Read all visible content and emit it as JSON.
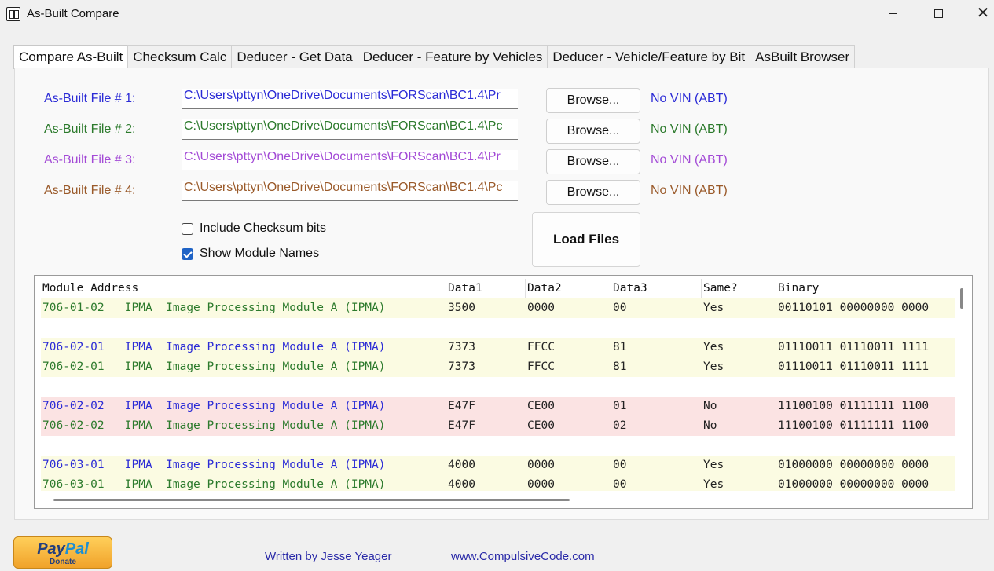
{
  "window": {
    "title": "As-Built Compare",
    "controls": {
      "minimize": "minimize-icon",
      "maximize": "maximize-icon",
      "close": "close-icon"
    }
  },
  "tabs": [
    {
      "label": "Compare As-Built",
      "active": true
    },
    {
      "label": "Checksum Calc"
    },
    {
      "label": "Deducer - Get Data"
    },
    {
      "label": "Deducer - Feature by Vehicles"
    },
    {
      "label": "Deducer - Vehicle/Feature by Bit"
    },
    {
      "label": "AsBuilt Browser"
    }
  ],
  "files": [
    {
      "label": "As-Built File # 1:",
      "path": "C:\\Users\\pttyn\\OneDrive\\Documents\\FORScan\\BC1.4\\Pr",
      "browse": "Browse...",
      "vin": "No VIN (ABT)",
      "color": "#2b2bd6"
    },
    {
      "label": "As-Built File # 2:",
      "path": "C:\\Users\\pttyn\\OneDrive\\Documents\\FORScan\\BC1.4\\Pc",
      "browse": "Browse...",
      "vin": "No VIN (ABT)",
      "color": "#2c7a2c"
    },
    {
      "label": "As-Built File # 3:",
      "path": "C:\\Users\\pttyn\\OneDrive\\Documents\\FORScan\\BC1.4\\Pr",
      "browse": "Browse...",
      "vin": "No VIN (ABT)",
      "color": "#a34ad6"
    },
    {
      "label": "As-Built File # 4:",
      "path": "C:\\Users\\pttyn\\OneDrive\\Documents\\FORScan\\BC1.4\\Pc",
      "browse": "Browse...",
      "vin": "No VIN (ABT)",
      "color": "#9a5a2a"
    }
  ],
  "options": {
    "include_checksum": {
      "label": "Include Checksum bits",
      "checked": false
    },
    "show_module_names": {
      "label": "Show Module Names",
      "checked": true
    }
  },
  "load_button": "Load Files",
  "grid": {
    "headers": [
      "Module Address",
      "Data1",
      "Data2",
      "Data3",
      "Same?",
      "Binary"
    ],
    "rows": [
      {
        "addr": "706-01-02   IPMA  Image Processing Module A (IPMA)",
        "d1": "3500",
        "d2": "0000",
        "d3": "00",
        "same": "Yes",
        "bin": "00110101 00000000 0000",
        "bg": "yellow",
        "color": "#2c7a2c"
      },
      {
        "addr": "",
        "d1": "",
        "d2": "",
        "d3": "",
        "same": "",
        "bin": "",
        "bg": "white",
        "color": "#222"
      },
      {
        "addr": "706-02-01   IPMA  Image Processing Module A (IPMA)",
        "d1": "7373",
        "d2": "FFCC",
        "d3": "81",
        "same": "Yes",
        "bin": "01110011 01110011 1111",
        "bg": "yellow",
        "color": "#2b2bd6"
      },
      {
        "addr": "706-02-01   IPMA  Image Processing Module A (IPMA)",
        "d1": "7373",
        "d2": "FFCC",
        "d3": "81",
        "same": "Yes",
        "bin": "01110011 01110011 1111",
        "bg": "yellow",
        "color": "#2c7a2c"
      },
      {
        "addr": "",
        "d1": "",
        "d2": "",
        "d3": "",
        "same": "",
        "bin": "",
        "bg": "white",
        "color": "#222"
      },
      {
        "addr": "706-02-02   IPMA  Image Processing Module A (IPMA)",
        "d1": "E47F",
        "d2": "CE00",
        "d3": "01",
        "same": "No",
        "bin": "11100100 01111111 1100",
        "bg": "red",
        "color": "#2b2bd6"
      },
      {
        "addr": "706-02-02   IPMA  Image Processing Module A (IPMA)",
        "d1": "E47F",
        "d2": "CE00",
        "d3": "02",
        "same": "No",
        "bin": "11100100 01111111 1100",
        "bg": "red",
        "color": "#2c7a2c"
      },
      {
        "addr": "",
        "d1": "",
        "d2": "",
        "d3": "",
        "same": "",
        "bin": "",
        "bg": "white",
        "color": "#222"
      },
      {
        "addr": "706-03-01   IPMA  Image Processing Module A (IPMA)",
        "d1": "4000",
        "d2": "0000",
        "d3": "00",
        "same": "Yes",
        "bin": "01000000 00000000 0000",
        "bg": "yellow",
        "color": "#2b2bd6"
      },
      {
        "addr": "706-03-01   IPMA  Image Processing Module A (IPMA)",
        "d1": "4000",
        "d2": "0000",
        "d3": "00",
        "same": "Yes",
        "bin": "01000000 00000000 0000",
        "bg": "yellow",
        "color": "#2c7a2c"
      }
    ]
  },
  "footer": {
    "paypal_logo_a": "Pay",
    "paypal_logo_b": "Pal",
    "paypal_donate": "Donate",
    "author": "Written by Jesse Yeager",
    "website": "www.CompulsiveCode.com"
  }
}
